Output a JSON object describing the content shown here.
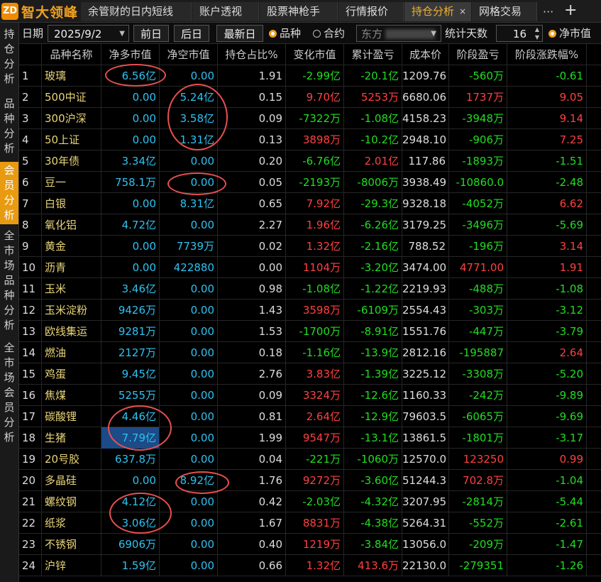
{
  "app": {
    "logo_mark": "ZD",
    "logo_text": "智大领峰"
  },
  "tabs": [
    {
      "label": "余管财的日内短线",
      "active": false
    },
    {
      "label": "账户透视",
      "active": false
    },
    {
      "label": "股票神枪手",
      "active": false
    },
    {
      "label": "行情报价",
      "active": false
    },
    {
      "label": "持仓分析",
      "active": true,
      "close": "×"
    },
    {
      "label": "网格交易",
      "active": false
    }
  ],
  "tab_more": "···",
  "tab_add": "+",
  "leftnav": [
    {
      "label": "持仓分析",
      "active": false
    },
    {
      "label": "品种分析",
      "active": false
    },
    {
      "label": "会员分析",
      "active": true
    },
    {
      "label": "全市场品种分析",
      "active": false
    },
    {
      "label": "全市场会员分析",
      "active": false
    }
  ],
  "toolbar": {
    "date_label": "日期",
    "date_value": "2025/9/2",
    "prev": "前日",
    "next": "后日",
    "latest": "最新日",
    "radio_variety": "品种",
    "radio_contract": "合约",
    "contract_value": "东方",
    "days_label": "统计天数",
    "days_value": "16",
    "net_value": "净市值"
  },
  "columns": [
    "",
    "品种名称",
    "净多市值",
    "净空市值",
    "持仓占比%",
    "变化市值",
    "累计盈亏",
    "成本价",
    "阶段盈亏",
    "阶段涨跌幅%"
  ],
  "rows": [
    [
      "1",
      "玻璃",
      "6.56亿",
      "0.00",
      "1.91",
      "-2.99亿",
      "-20.1亿",
      "1209.76",
      "-560万",
      "-0.61"
    ],
    [
      "2",
      "500中证",
      "0.00",
      "5.24亿",
      "0.15",
      "9.70亿",
      "5253万",
      "6680.06",
      "1737万",
      "9.05"
    ],
    [
      "3",
      "300沪深",
      "0.00",
      "3.58亿",
      "0.09",
      "-7322万",
      "-1.08亿",
      "4158.23",
      "-3948万",
      "9.14"
    ],
    [
      "4",
      "50上证",
      "0.00",
      "1.31亿",
      "0.13",
      "3898万",
      "-10.2亿",
      "2948.10",
      "-906万",
      "7.25"
    ],
    [
      "5",
      "30年债",
      "3.34亿",
      "0.00",
      "0.20",
      "-6.76亿",
      "2.01亿",
      "117.86",
      "-1893万",
      "-1.51"
    ],
    [
      "6",
      "豆一",
      "758.1万",
      "0.00",
      "0.05",
      "-2193万",
      "-8006万",
      "3938.49",
      "-10860.0",
      "-2.48"
    ],
    [
      "7",
      "白银",
      "0.00",
      "8.31亿",
      "0.65",
      "7.92亿",
      "-29.3亿",
      "9328.18",
      "-4052万",
      "6.62"
    ],
    [
      "8",
      "氧化铝",
      "4.72亿",
      "0.00",
      "2.27",
      "1.96亿",
      "-6.26亿",
      "3179.25",
      "-3496万",
      "-5.69"
    ],
    [
      "9",
      "黄金",
      "0.00",
      "7739万",
      "0.02",
      "1.32亿",
      "-2.16亿",
      "788.52",
      "-196万",
      "3.14"
    ],
    [
      "10",
      "沥青",
      "0.00",
      "422880",
      "0.00",
      "1104万",
      "-3.20亿",
      "3474.00",
      "4771.00",
      "1.91"
    ],
    [
      "11",
      "玉米",
      "3.46亿",
      "0.00",
      "0.98",
      "-1.08亿",
      "-1.22亿",
      "2219.93",
      "-488万",
      "-1.08"
    ],
    [
      "12",
      "玉米淀粉",
      "9426万",
      "0.00",
      "1.43",
      "3598万",
      "-6109万",
      "2554.43",
      "-303万",
      "-3.12"
    ],
    [
      "13",
      "欧线集运",
      "9281万",
      "0.00",
      "1.53",
      "-1700万",
      "-8.91亿",
      "1551.76",
      "-447万",
      "-3.79"
    ],
    [
      "14",
      "燃油",
      "2127万",
      "0.00",
      "0.18",
      "-1.16亿",
      "-13.9亿",
      "2812.16",
      "-195887",
      "2.64"
    ],
    [
      "15",
      "鸡蛋",
      "9.45亿",
      "0.00",
      "2.76",
      "3.83亿",
      "-1.39亿",
      "3225.12",
      "-3308万",
      "-5.20"
    ],
    [
      "16",
      "焦煤",
      "5255万",
      "0.00",
      "0.09",
      "3324万",
      "-12.6亿",
      "1160.33",
      "-242万",
      "-9.89"
    ],
    [
      "17",
      "碳酸锂",
      "4.46亿",
      "0.00",
      "0.81",
      "2.64亿",
      "-12.9亿",
      "79603.5",
      "-6065万",
      "-9.69"
    ],
    [
      "18",
      "生猪",
      "7.79亿",
      "0.00",
      "1.99",
      "9547万",
      "-13.1亿",
      "13861.5",
      "-1801万",
      "-3.17"
    ],
    [
      "19",
      "20号胶",
      "637.8万",
      "0.00",
      "0.04",
      "-221万",
      "-1060万",
      "12570.0",
      "123250",
      "0.99"
    ],
    [
      "20",
      "多晶硅",
      "0.00",
      "8.92亿",
      "1.76",
      "9272万",
      "-3.60亿",
      "51244.3",
      "702.8万",
      "-1.04"
    ],
    [
      "21",
      "螺纹钢",
      "4.12亿",
      "0.00",
      "0.42",
      "-2.03亿",
      "-4.32亿",
      "3207.95",
      "-2814万",
      "-5.44"
    ],
    [
      "22",
      "纸浆",
      "3.06亿",
      "0.00",
      "1.67",
      "8831万",
      "-4.38亿",
      "5264.31",
      "-552万",
      "-2.61"
    ],
    [
      "23",
      "不锈钢",
      "6906万",
      "0.00",
      "0.40",
      "1219万",
      "-3.84亿",
      "13056.0",
      "-209万",
      "-1.47"
    ],
    [
      "24",
      "沪锌",
      "1.59亿",
      "0.00",
      "0.66",
      "1.32亿",
      "413.6万",
      "22130.0",
      "-279351",
      "-1.26"
    ]
  ],
  "colors": {
    "accent": "#f0a020",
    "up": "#ff4040",
    "down": "#22dd22",
    "value": "#2ec2f0",
    "name": "#e8d478",
    "annotation": "#e85050"
  }
}
